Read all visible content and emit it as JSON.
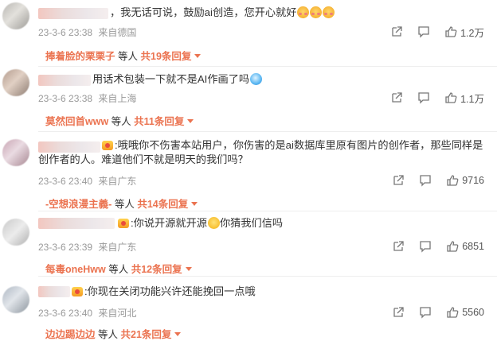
{
  "comments": [
    {
      "text": "，我无话可说，鼓励ai创造，您开心就好",
      "time": "23-3-6 23:38",
      "location": "来自德国",
      "likes": "1.2万",
      "reply_name": "捧着脸的栗栗子",
      "reply_mid": "等人",
      "reply_count": "共19条回复",
      "emojis": [
        "blush-emoji",
        "blush-emoji",
        "blush-emoji"
      ]
    },
    {
      "text": "用话术包装一下就不是AI作画了吗",
      "time": "23-3-6 23:38",
      "location": "来自上海",
      "likes": "1.1万",
      "reply_name": "莫然回首www",
      "reply_mid": "等人",
      "reply_count": "共11条回复",
      "emojis": [
        "doraemon-emoji"
      ]
    },
    {
      "text": ":哦哦你不伤害本站用户，你伤害的是ai数据库里原有图片的创作者，那些同样是创作者的人。难道他们不就是明天的我们吗？",
      "time": "23-3-6 23:40",
      "location": "来自广东",
      "likes": "9716",
      "reply_name": "-空想浪漫主義-",
      "reply_mid": "等人",
      "reply_count": "共14条回复"
    },
    {
      "text_a": ":你说开源就开源",
      "text_b": "你猜我们信吗",
      "time": "23-3-6 23:39",
      "location": "来自广东",
      "likes": "6851",
      "reply_name": "每毒oneHww",
      "reply_mid": "等人",
      "reply_count": "共12条回复",
      "emojis": [
        "grin-emoji"
      ]
    },
    {
      "text": ":你现在关闭功能兴许还能挽回一点哦",
      "time": "23-3-6 23:40",
      "location": "来自河北",
      "likes": "5560",
      "reply_name": "边边踢边边",
      "reply_mid": "等人",
      "reply_count": "共21条回复"
    }
  ],
  "icons": {
    "share": "share-icon",
    "comment": "comment-icon",
    "like": "thumbs-up-icon",
    "badge": "fan-badge-icon"
  },
  "colors": {
    "accent": "#eb7350",
    "meta": "#999999",
    "text": "#333333"
  }
}
